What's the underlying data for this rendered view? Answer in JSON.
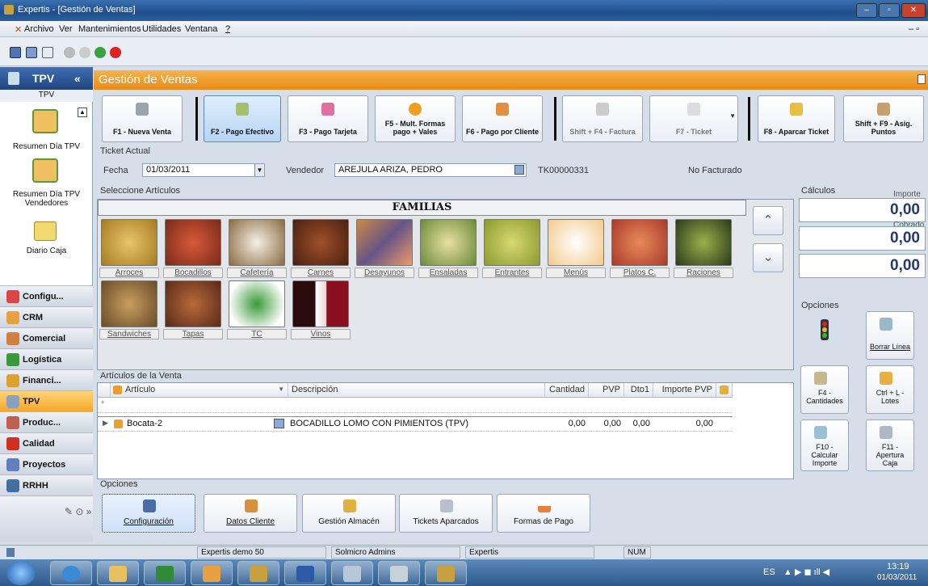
{
  "window": {
    "title": "Expertis - [Gestión de Ventas]"
  },
  "menu": [
    "Archivo",
    "Ver",
    "Mantenimientos",
    "Utilidades",
    "Ventana",
    "?"
  ],
  "sidebar": {
    "header": "TPV",
    "subheader": "TPV",
    "items": [
      {
        "label": "Resumen Día TPV"
      },
      {
        "label": "Resumen Día TPV Vendedores"
      },
      {
        "label": "Diario Caja"
      }
    ],
    "modules": [
      "Configu...",
      "CRM",
      "Comercial",
      "Logística",
      "Financi...",
      "TPV",
      "Produc...",
      "Calidad",
      "Proyectos",
      "RRHH"
    ]
  },
  "main": {
    "title": "Gestión de Ventas"
  },
  "actions": [
    {
      "label": "F1 - Nueva Venta"
    },
    {
      "label": "F2 - Pago Efectivo"
    },
    {
      "label": "F3 - Pago Tarjeta"
    },
    {
      "label": "F5 - Mult. Formas pago + Vales"
    },
    {
      "label": "F6 - Pago por Cliente"
    },
    {
      "label": "Shift + F4 - Factura"
    },
    {
      "label": "F7 - Ticket"
    },
    {
      "label": "F8 - Aparcar Ticket"
    },
    {
      "label": "Shift + F9 - Asig. Puntos"
    }
  ],
  "ticket": {
    "section": "Ticket Actual",
    "fecha_label": "Fecha",
    "fecha": "01/03/2011",
    "vendedor_label": "Vendedor",
    "vendedor": "AREJULA ARIZA, PEDRO",
    "ticket_num": "TK00000331",
    "estado": "No Facturado"
  },
  "articulos": {
    "section": "Seleccione Artículos",
    "familias_title": "FAMILIAS",
    "families": [
      "Arroces",
      "Bocadillos",
      "Cafetería",
      "Carnes",
      "Desayunos",
      "Ensaladas",
      "Entrantes",
      "Menús",
      "Platos C.",
      "Raciones",
      "Sandwiches",
      "Tapas",
      "TC",
      "Vinos"
    ]
  },
  "calculos": {
    "section": "Cálculos",
    "importe_label": "Importe",
    "cobrado_label": "Cobrado",
    "importe": "0,00",
    "cobrado": "0,00",
    "cambio": "0,00"
  },
  "opciones_right": {
    "section": "Opciones",
    "buttons": [
      "Borrar Línea",
      "F4 - Cantidades",
      "Ctrl + L - Lotes",
      "F10 - Calcular Importe",
      "F11 - Apertura Caja"
    ]
  },
  "venta": {
    "section": "Artículos de la Venta",
    "columns": [
      "Artículo",
      "Descripción",
      "Cantidad",
      "PVP",
      "Dto1",
      "Importe PVP"
    ],
    "rows": [
      {
        "articulo": "Bocata-2",
        "descripcion": "BOCADILLO LOMO CON PIMIENTOS (TPV)",
        "cantidad": "0,00",
        "pvp": "0,00",
        "dto1": "0,00",
        "importe": "0,00"
      }
    ]
  },
  "opciones_bottom": {
    "section": "Opciones",
    "buttons": [
      "Configuración",
      "Datos Cliente",
      "Gestión Almacén",
      "Tickets Aparcados",
      "Formas de Pago"
    ]
  },
  "statusbar": [
    "Expertis demo 50",
    "Solmicro Admins",
    "Expertis",
    "NUM"
  ],
  "taskbar": {
    "lang": "ES",
    "time": "13:19",
    "date": "01/03/2011"
  },
  "colors": {
    "accent": "#f0961e",
    "calc_text": "#203a78",
    "title_bar": "#2a5fa0"
  }
}
